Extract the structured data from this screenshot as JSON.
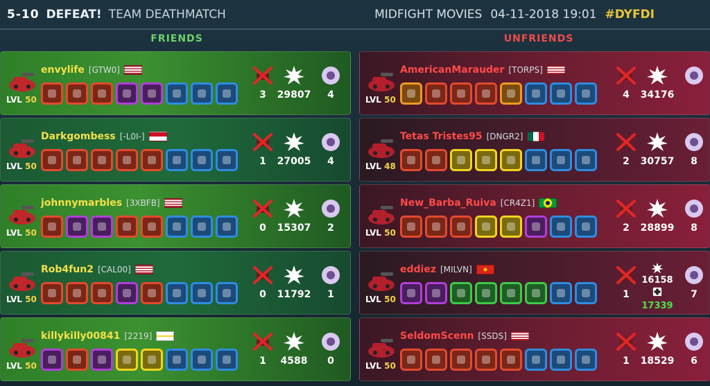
{
  "header": {
    "score": "5-10",
    "result": "DEFEAT!",
    "mode": "TEAM DEATHMATCH",
    "channel": "MIDFIGHT MOVIES",
    "datetime": "04-11-2018 19:01",
    "hashtag": "#DYFDI"
  },
  "columns": {
    "friends": "FRIENDS",
    "unfriends": "UNFRIENDS"
  },
  "friends": [
    {
      "name": "envylife",
      "tag": "[GTW0]",
      "flag": "us",
      "lvl_label": "LVL",
      "lvl": "50",
      "deaths": "3",
      "damage": "29807",
      "coins": "4",
      "items": [
        "red",
        "red",
        "red",
        "purple",
        "purple",
        "blue",
        "blue",
        "blue"
      ]
    },
    {
      "name": "Darkgombess",
      "tag": "[-L0I-]",
      "flag": "id",
      "lvl_label": "LVL",
      "lvl": "50",
      "deaths": "1",
      "damage": "27005",
      "coins": "4",
      "items": [
        "red",
        "red",
        "red",
        "red",
        "red",
        "blue",
        "blue",
        "blue"
      ]
    },
    {
      "name": "johnnymarbles",
      "tag": "[3XBFB]",
      "flag": "us",
      "lvl_label": "LVL",
      "lvl": "50",
      "deaths": "0",
      "damage": "15307",
      "coins": "2",
      "items": [
        "red",
        "purple",
        "purple",
        "red",
        "red",
        "blue",
        "blue",
        "blue"
      ]
    },
    {
      "name": "Rob4fun2",
      "tag": "[CAL00]",
      "flag": "us",
      "lvl_label": "LVL",
      "lvl": "50",
      "deaths": "0",
      "damage": "11792",
      "coins": "1",
      "items": [
        "red",
        "red",
        "red",
        "purple",
        "red",
        "blue",
        "blue",
        "blue"
      ]
    },
    {
      "name": "killykilly00841",
      "tag": "[2219]",
      "flag": "vi",
      "lvl_label": "LVL",
      "lvl": "50",
      "deaths": "1",
      "damage": "4588",
      "coins": "0",
      "items": [
        "purple",
        "red",
        "purple",
        "yellow",
        "yellow",
        "blue",
        "blue",
        "blue"
      ]
    }
  ],
  "unfriends": [
    {
      "name": "AmericanMarauder",
      "tag": "[TORPS]",
      "flag": "us",
      "lvl_label": "LVL",
      "lvl": "50",
      "deaths": "4",
      "damage": "34176",
      "coins": "",
      "items": [
        "orange",
        "red",
        "red",
        "red",
        "orange",
        "blue",
        "blue",
        "blue"
      ]
    },
    {
      "name": "Tetas Tristes95",
      "tag": "[DNGR2]",
      "flag": "mx",
      "lvl_label": "LVL",
      "lvl": "48",
      "deaths": "2",
      "damage": "30757",
      "coins": "8",
      "items": [
        "red",
        "red",
        "yellow",
        "yellow",
        "yellow",
        "blue",
        "blue",
        "blue"
      ]
    },
    {
      "name": "New_Barba_Ruiva",
      "tag": "[CR4Z1]",
      "flag": "br",
      "lvl_label": "LVL",
      "lvl": "50",
      "deaths": "2",
      "damage": "28899",
      "coins": "8",
      "items": [
        "red",
        "red",
        "red",
        "yellow",
        "yellow",
        "purple",
        "blue",
        "blue"
      ]
    },
    {
      "name": "eddiez",
      "tag": "[MILVN]",
      "flag": "vn",
      "lvl_label": "LVL",
      "lvl": "50",
      "deaths": "1",
      "damage": "16158",
      "heal": "17339",
      "coins": "7",
      "items": [
        "purple",
        "purple",
        "green",
        "green",
        "green",
        "green",
        "blue",
        "blue"
      ]
    },
    {
      "name": "SeldomScenn",
      "tag": "[SSDS]",
      "flag": "us",
      "lvl_label": "LVL",
      "lvl": "50",
      "deaths": "1",
      "damage": "18529",
      "coins": "6",
      "items": [
        "red",
        "red",
        "red",
        "red",
        "red",
        "blue",
        "blue",
        "blue"
      ]
    }
  ],
  "colors": {
    "friends_header": "#6dd36a",
    "unfriends_header": "#ef4b4b",
    "friend_name": "#f3e14a",
    "unfriend_name": "#ff4a4a",
    "heal": "#4fe04a",
    "lvl_number": "#f1d34a"
  },
  "icons": {
    "death": "crossed-tank-icon",
    "damage": "explosion-icon",
    "coin": "coin-icon",
    "heal": "heal-icon"
  }
}
